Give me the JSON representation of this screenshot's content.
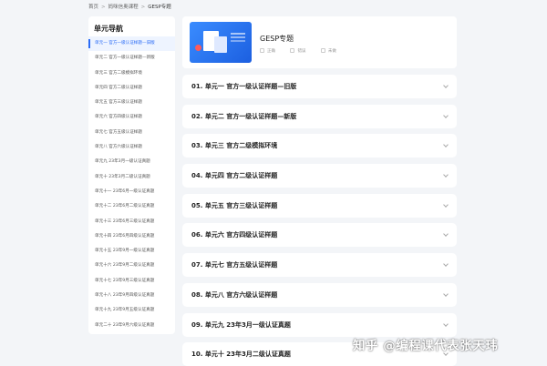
{
  "breadcrumb": {
    "items": [
      "首页",
      "妈咪信奥课程",
      "GESP专题"
    ],
    "sep": ">"
  },
  "sidebar": {
    "title": "单元导航",
    "items": [
      {
        "label": "单元一 官方一级认证样题—旧版"
      },
      {
        "label": "单元二 官方一级认证样题—新版"
      },
      {
        "label": "单元三 官方二级模拟环境"
      },
      {
        "label": "单元四 官方二级认证样题"
      },
      {
        "label": "单元五 官方三级认证样题"
      },
      {
        "label": "单元六 官方四级认证样题"
      },
      {
        "label": "单元七 官方五级认证样题"
      },
      {
        "label": "单元八 官方六级认证样题"
      },
      {
        "label": "单元九 23年3月一级认证真题"
      },
      {
        "label": "单元十 23年3月二级认证真题"
      },
      {
        "label": "单元十一 23年6月一级认证真题"
      },
      {
        "label": "单元十二 23年6月二级认证真题"
      },
      {
        "label": "单元十三 23年6月三级认证真题"
      },
      {
        "label": "单元十四 23年6月四级认证真题"
      },
      {
        "label": "单元十五 23年9月一级认证真题"
      },
      {
        "label": "单元十六 23年9月二级认证真题"
      },
      {
        "label": "单元十七 23年9月三级认证真题"
      },
      {
        "label": "单元十八 23年9月四级认证真题"
      },
      {
        "label": "单元十九 23年9月五级认证真题"
      },
      {
        "label": "单元二十 23年9月六级认证真题"
      }
    ]
  },
  "banner": {
    "title": "GESP专题",
    "legend": [
      "正确",
      "错误",
      "未做"
    ]
  },
  "units": [
    {
      "title": "01. 单元一 官方一级认证样题—旧版"
    },
    {
      "title": "02. 单元二 官方一级认证样题—新版"
    },
    {
      "title": "03. 单元三 官方二级模拟环境"
    },
    {
      "title": "04. 单元四 官方二级认证样题"
    },
    {
      "title": "05. 单元五 官方三级认证样题"
    },
    {
      "title": "06. 单元六 官方四级认证样题"
    },
    {
      "title": "07. 单元七 官方五级认证样题"
    },
    {
      "title": "08. 单元八 官方六级认证样题"
    },
    {
      "title": "09. 单元九 23年3月一级认证真题"
    },
    {
      "title": "10. 单元十 23年3月二级认证真题"
    }
  ],
  "watermark": "知乎 @编程课代表张天玮",
  "colors": {
    "accent": "#2b6cf6",
    "background": "#f3f5f8"
  }
}
